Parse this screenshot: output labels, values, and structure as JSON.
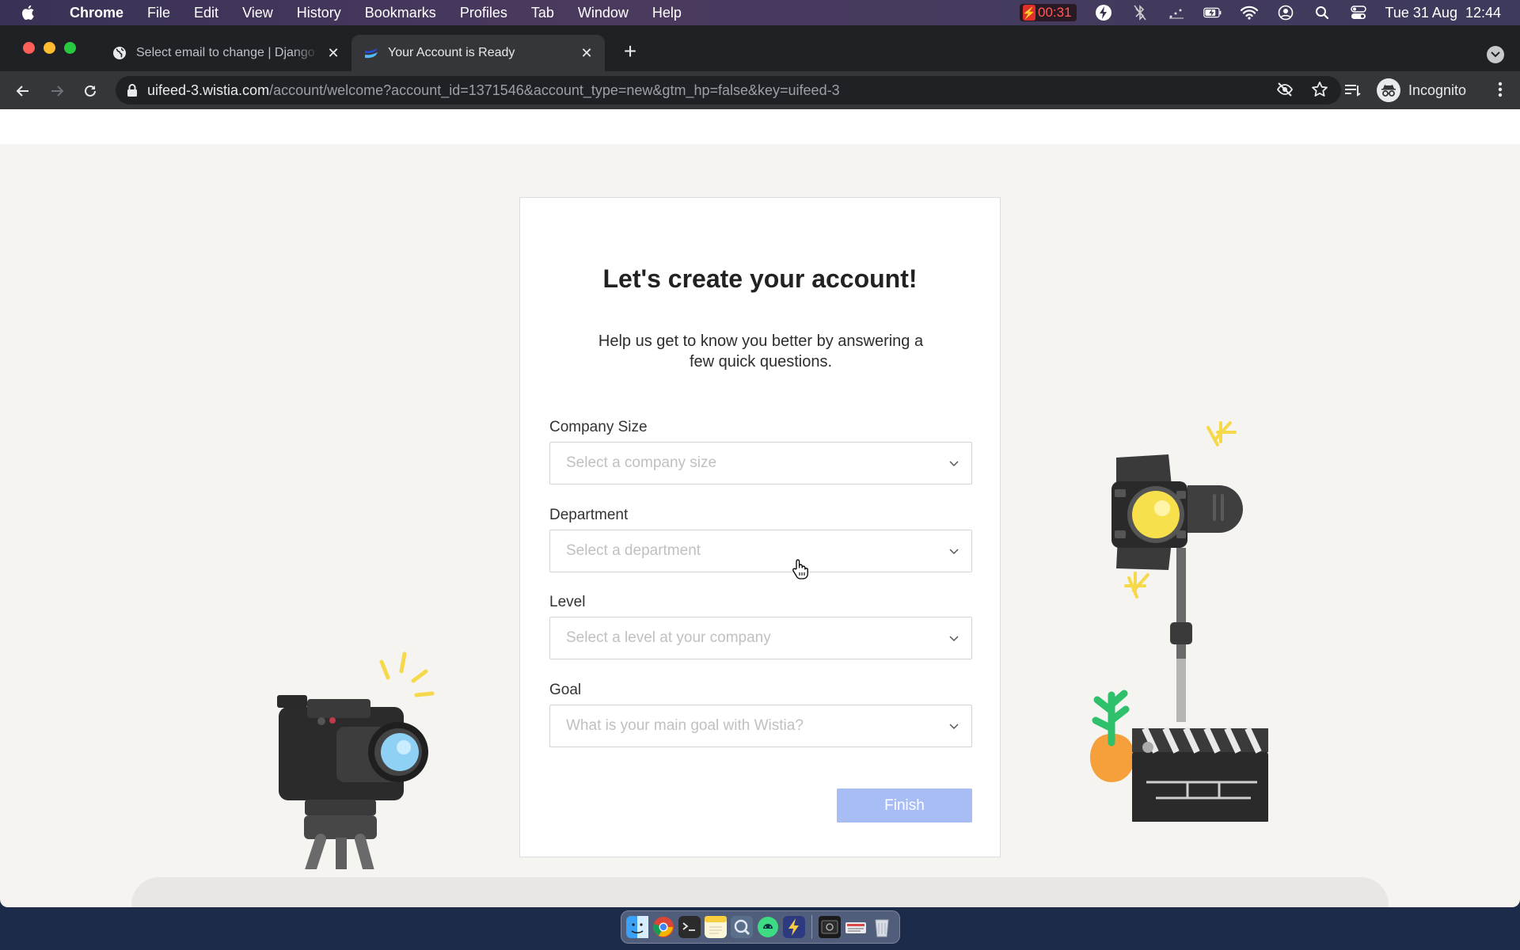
{
  "menubar": {
    "app_name": "Chrome",
    "items": [
      "File",
      "Edit",
      "View",
      "History",
      "Bookmarks",
      "Profiles",
      "Tab",
      "Window",
      "Help"
    ],
    "timer": "00:31",
    "datetime": "Tue 31 Aug  12:44"
  },
  "browser": {
    "tabs": [
      {
        "title": "Select email to change | Django",
        "active": false
      },
      {
        "title": "Your Account is Ready",
        "active": true
      }
    ],
    "url_host": "uifeed-3.wistia.com",
    "url_path": "/account/welcome?account_id=1371546&account_type=new&gtm_hp=false&key=uifeed-3",
    "profile_label": "Incognito"
  },
  "form": {
    "title": "Let's create your account!",
    "subtitle": "Help us get to know you better by answering a few quick questions.",
    "fields": [
      {
        "label": "Company Size",
        "placeholder": "Select a company size"
      },
      {
        "label": "Department",
        "placeholder": "Select a department"
      },
      {
        "label": "Level",
        "placeholder": "Select a level at your company"
      },
      {
        "label": "Goal",
        "placeholder": "What is your main goal with Wistia?"
      }
    ],
    "submit_label": "Finish"
  },
  "colors": {
    "accent_disabled": "#a9bdf5",
    "page_bg": "#f5f4f1",
    "lamp_light": "#f7e04b",
    "lens": "#8fd0f5"
  },
  "dock": {
    "apps": [
      "finder-icon",
      "chrome-icon",
      "terminal-icon",
      "notes-icon",
      "preview-icon",
      "android-studio-icon",
      "bolt-app-icon",
      "screenshot-icon",
      "keyboard-icon",
      "trash-icon"
    ]
  }
}
